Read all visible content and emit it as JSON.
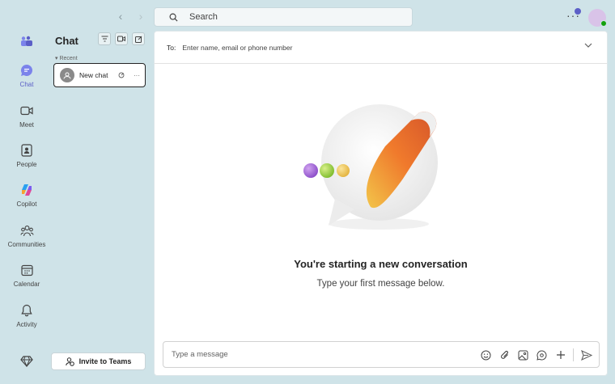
{
  "search": {
    "placeholder": "Search"
  },
  "rail": {
    "items": [
      {
        "label": "Chat",
        "icon": "chat-icon",
        "active": true
      },
      {
        "label": "Meet",
        "icon": "video-camera-icon"
      },
      {
        "label": "People",
        "icon": "people-icon"
      },
      {
        "label": "Copilot",
        "icon": "copilot-icon"
      },
      {
        "label": "Communities",
        "icon": "communities-icon"
      },
      {
        "label": "Calendar",
        "icon": "calendar-icon"
      },
      {
        "label": "Activity",
        "icon": "bell-icon"
      }
    ]
  },
  "chat_pane": {
    "title": "Chat",
    "section": "Recent",
    "items": [
      {
        "label": "New chat"
      }
    ],
    "invite_label": "Invite to Teams"
  },
  "main": {
    "to_label": "To:",
    "to_placeholder": "Enter name, email or phone number",
    "heading": "You're starting a new conversation",
    "subheading": "Type your first message below.",
    "compose_placeholder": "Type a message"
  },
  "colors": {
    "accent": "#5b5fc7",
    "background": "#cfe3e8",
    "presence": "#13a10e"
  }
}
